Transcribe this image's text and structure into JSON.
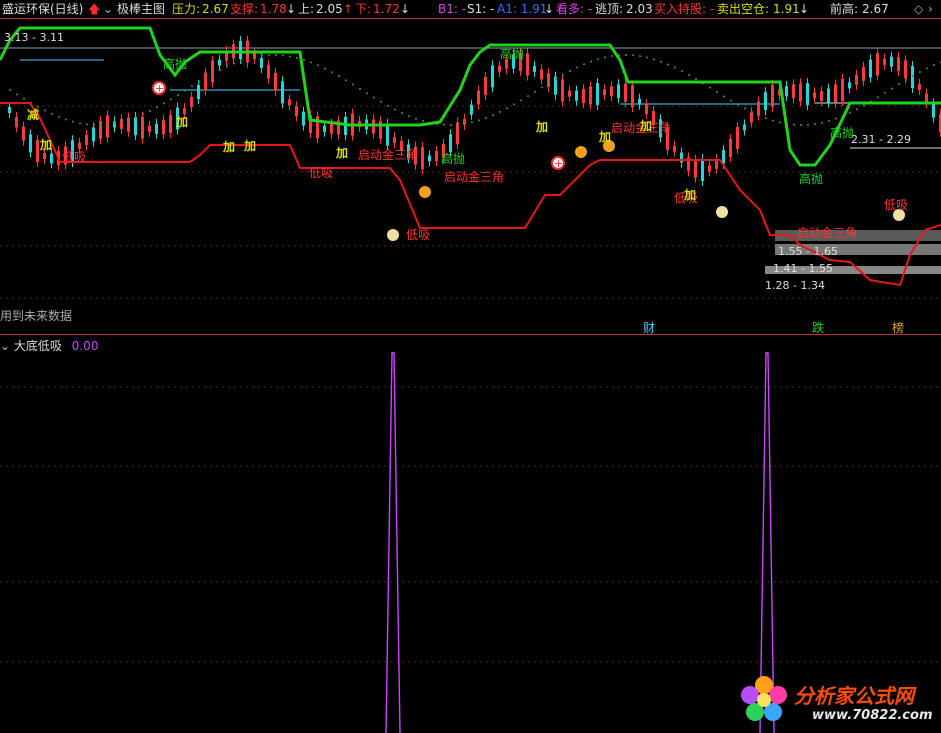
{
  "header": {
    "stock_title": "盛运环保(日线)",
    "indicator_name": "极棒主图",
    "pressure": {
      "label": "压力:",
      "value": "2.67"
    },
    "support": {
      "label": "支撑:",
      "value": "1.78"
    },
    "up": {
      "label": "上:",
      "value": "2.05"
    },
    "down": {
      "label": "下:",
      "value": "1.72"
    },
    "b1": "B1: -",
    "s1": "S1: -",
    "a1": "A1: 1.91",
    "kan_duo": "看多: -",
    "escape_top": {
      "label": "逃顶:",
      "value": "2.03"
    },
    "buy_hold": "买入持股: -",
    "sell_empty": {
      "label": "卖出空仓:",
      "value": "1.91"
    },
    "prev_high": {
      "label": "前高:",
      "value": "2.67"
    }
  },
  "main_chart": {
    "price_labels": [
      "3.13 - 3.11",
      "2.31 - 2.29",
      "1.55 - 1.65",
      "1.41 - 1.55",
      "1.28 - 1.34"
    ],
    "signal_labels": {
      "gao_pao": "高抛",
      "di_xi": "低吸",
      "jia": "加",
      "jian": "减",
      "qi_dong": "启动金三角",
      "fu_huo": "复活",
      "dan_dao": "当前"
    },
    "future_note": "用到未来数据",
    "markers": {
      "cai": "财",
      "die": "跌",
      "bang": "榜"
    }
  },
  "sub_chart": {
    "title": "大底低吸",
    "value": "0.00"
  },
  "colors": {
    "resistance": "#22d21e",
    "support": "#e8161b",
    "bull": "#ff3a3a",
    "bear": "#26d6d6",
    "ma_dots": "#2ea02e",
    "spike": "#cc44ff",
    "title_red": "#ff3333"
  },
  "watermark": {
    "title": "分析家公式网",
    "url": "www.70822.com"
  }
}
